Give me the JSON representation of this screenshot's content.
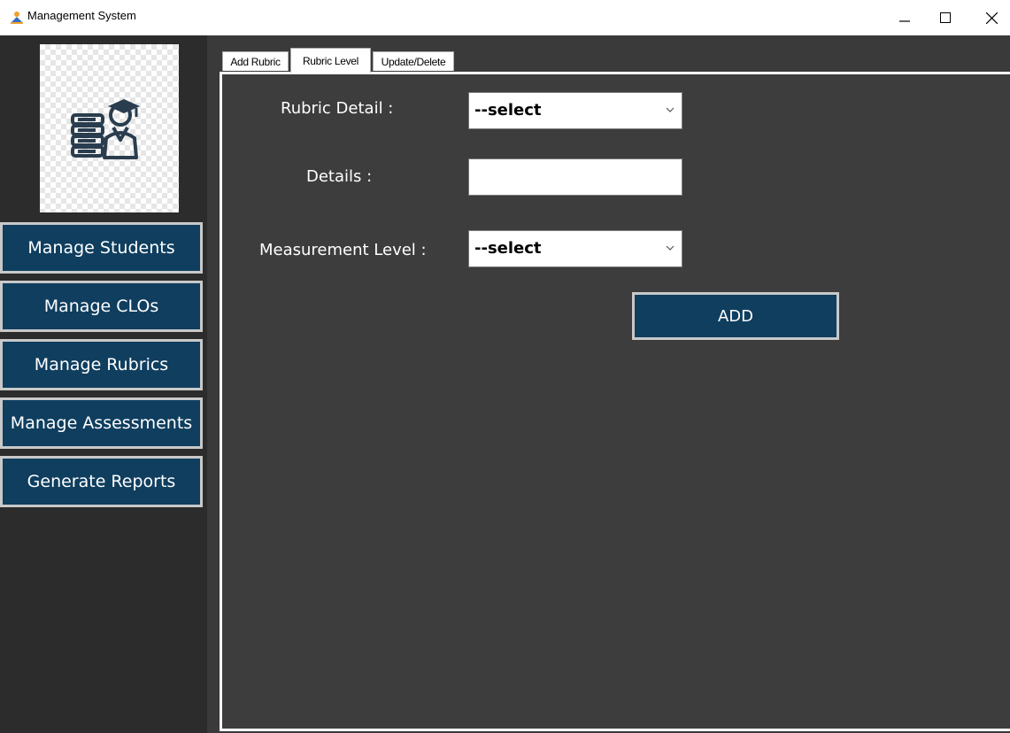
{
  "window": {
    "title": "Management System",
    "icon": "app-person-icon"
  },
  "sidebar": {
    "logo_icon": "books-graduate-icon",
    "items": [
      {
        "label": "Manage Students"
      },
      {
        "label": "Manage CLOs"
      },
      {
        "label": "Manage Rubrics"
      },
      {
        "label": "Manage Assessments"
      },
      {
        "label": "Generate Reports"
      }
    ]
  },
  "tabs": [
    {
      "label": "Add Rubric",
      "active": false
    },
    {
      "label": "Rubric Level",
      "active": true
    },
    {
      "label": "Update/Delete",
      "active": false
    }
  ],
  "form": {
    "rubric_detail_label": "Rubric Detail :",
    "rubric_detail_value": "--select",
    "details_label": "Details :",
    "details_value": "",
    "measurement_label": "Measurement Level :",
    "measurement_value": "--select",
    "add_label": "ADD"
  },
  "colors": {
    "button_bg": "#0f3e5f",
    "sidebar_bg": "#2c2c2c",
    "panel_bg": "#3d3d3d"
  }
}
